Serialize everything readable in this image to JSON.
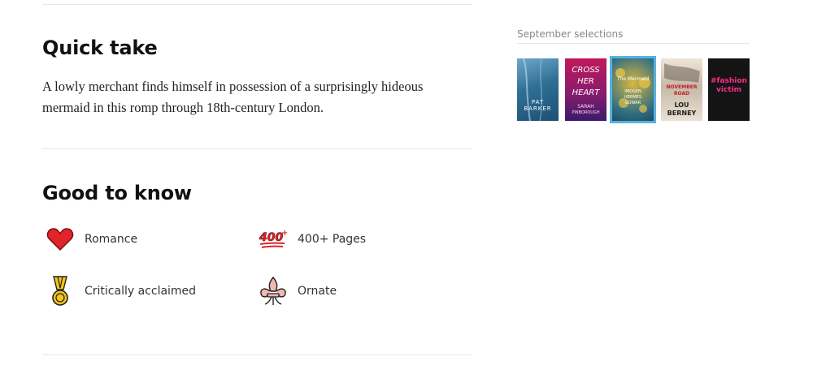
{
  "quick_take": {
    "heading": "Quick take",
    "text": "A lowly merchant finds himself in possession of a surprisingly hideous mermaid in this romp through 18th-century London."
  },
  "good_to_know": {
    "heading": "Good to know",
    "items": [
      {
        "label": "Romance",
        "icon": "heart-icon"
      },
      {
        "label": "400+ Pages",
        "icon": "hundred-points-icon"
      },
      {
        "label": "Critically acclaimed",
        "icon": "medal-icon"
      },
      {
        "label": "Ornate",
        "icon": "fleur-de-lis-icon"
      }
    ]
  },
  "sidebar": {
    "title": "September selections",
    "books": [
      {
        "cover_lines": [
          "PAT",
          "BARKER"
        ]
      },
      {
        "cover_lines": [
          "CROSS",
          "HER",
          "HEART",
          "SARAH",
          "PINBOROUGH"
        ]
      },
      {
        "cover_lines": [
          "The Mermaid",
          "IMOGEN",
          "HERMES",
          "GOWAR"
        ],
        "selected": true
      },
      {
        "cover_lines": [
          "NOVEMBER",
          "ROAD",
          "LOU",
          "BERNEY"
        ]
      },
      {
        "cover_lines": [
          "#fashion",
          "victim"
        ]
      }
    ]
  },
  "colors": {
    "selected_outline": "#5ab0e0",
    "heart": "#e0242a",
    "medal": "#f5c518"
  }
}
